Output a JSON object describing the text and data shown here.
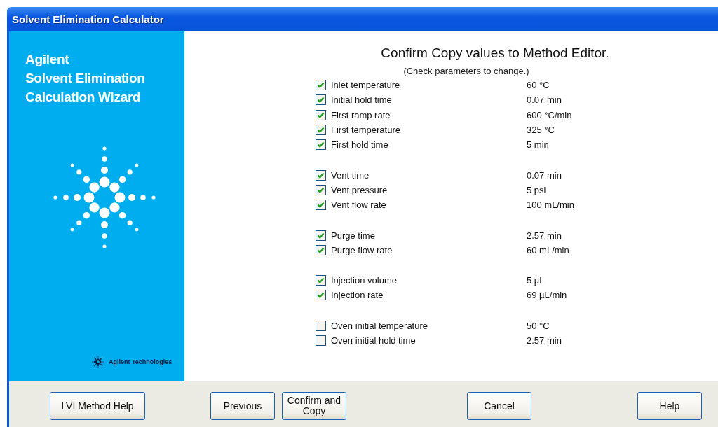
{
  "window": {
    "title": "Solvent Elimination Calculator"
  },
  "sidebar": {
    "heading_lines": [
      "Agilent",
      "Solvent Elimination",
      "Calculation Wizard"
    ],
    "footer_brand": "Agilent Technologies"
  },
  "main": {
    "title": "Confirm Copy values to Method Editor.",
    "subtitle": "(Check parameters to change.)",
    "groups": [
      {
        "items": [
          {
            "label": "Inlet temperature",
            "value": "60 °C",
            "checked": true
          },
          {
            "label": "Initial hold time",
            "value": "0.07 min",
            "checked": true
          },
          {
            "label": "First ramp rate",
            "value": "600 °C/min",
            "checked": true
          },
          {
            "label": "First temperature",
            "value": "325 °C",
            "checked": true
          },
          {
            "label": "First hold time",
            "value": "5 min",
            "checked": true
          }
        ]
      },
      {
        "items": [
          {
            "label": "Vent time",
            "value": "0.07 min",
            "checked": true
          },
          {
            "label": "Vent pressure",
            "value": "5 psi",
            "checked": true
          },
          {
            "label": "Vent flow rate",
            "value": "100 mL/min",
            "checked": true
          }
        ]
      },
      {
        "items": [
          {
            "label": "Purge time",
            "value": "2.57 min",
            "checked": true
          },
          {
            "label": "Purge flow rate",
            "value": "60 mL/min",
            "checked": true
          }
        ]
      },
      {
        "items": [
          {
            "label": "Injection volume",
            "value": "5 µL",
            "checked": true
          },
          {
            "label": "Injection rate",
            "value": "69 µL/min",
            "checked": true
          }
        ]
      },
      {
        "items": [
          {
            "label": "Oven initial temperature",
            "value": "50 °C",
            "checked": false
          },
          {
            "label": "Oven initial hold time",
            "value": "2.57 min",
            "checked": false
          }
        ]
      }
    ]
  },
  "buttons": [
    "LVI Method Help",
    "Previous",
    "Confirm and Copy",
    "Cancel",
    "Help"
  ]
}
